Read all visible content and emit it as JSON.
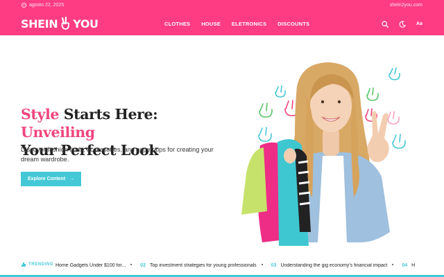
{
  "header": {
    "date": "agosto 22, 2025",
    "site_url": "shein2you.com",
    "logo_left": "SHEIN",
    "logo_right": "YOU",
    "nav": [
      "CLOTHES",
      "HOUSE",
      "ELETRONICS",
      "DISCOUNTS"
    ],
    "lang_label": "Aa"
  },
  "hero": {
    "title_pink_1": "Style",
    "title_dark_1": "Starts Here:",
    "title_pink_2": "Unveiling",
    "title_dark_2": "Your Perfect Look",
    "description": "Discover fashion finds, accessories, and expert tips for creating your dream wardrobe.",
    "cta_label": "Explore Content"
  },
  "ticker": {
    "label": "TRENDING",
    "items": [
      {
        "num": "",
        "text": "Home Gadgets Under $100 for..."
      },
      {
        "num": "02",
        "text": "Top investment strategies for young professionals"
      },
      {
        "num": "03",
        "text": "Understanding the gig economy's financial impact"
      },
      {
        "num": "04",
        "text": "H"
      }
    ]
  },
  "colors": {
    "brand_pink": "#fd3c84",
    "accent_teal": "#45c8d6",
    "title_pink": "#f0457d"
  }
}
